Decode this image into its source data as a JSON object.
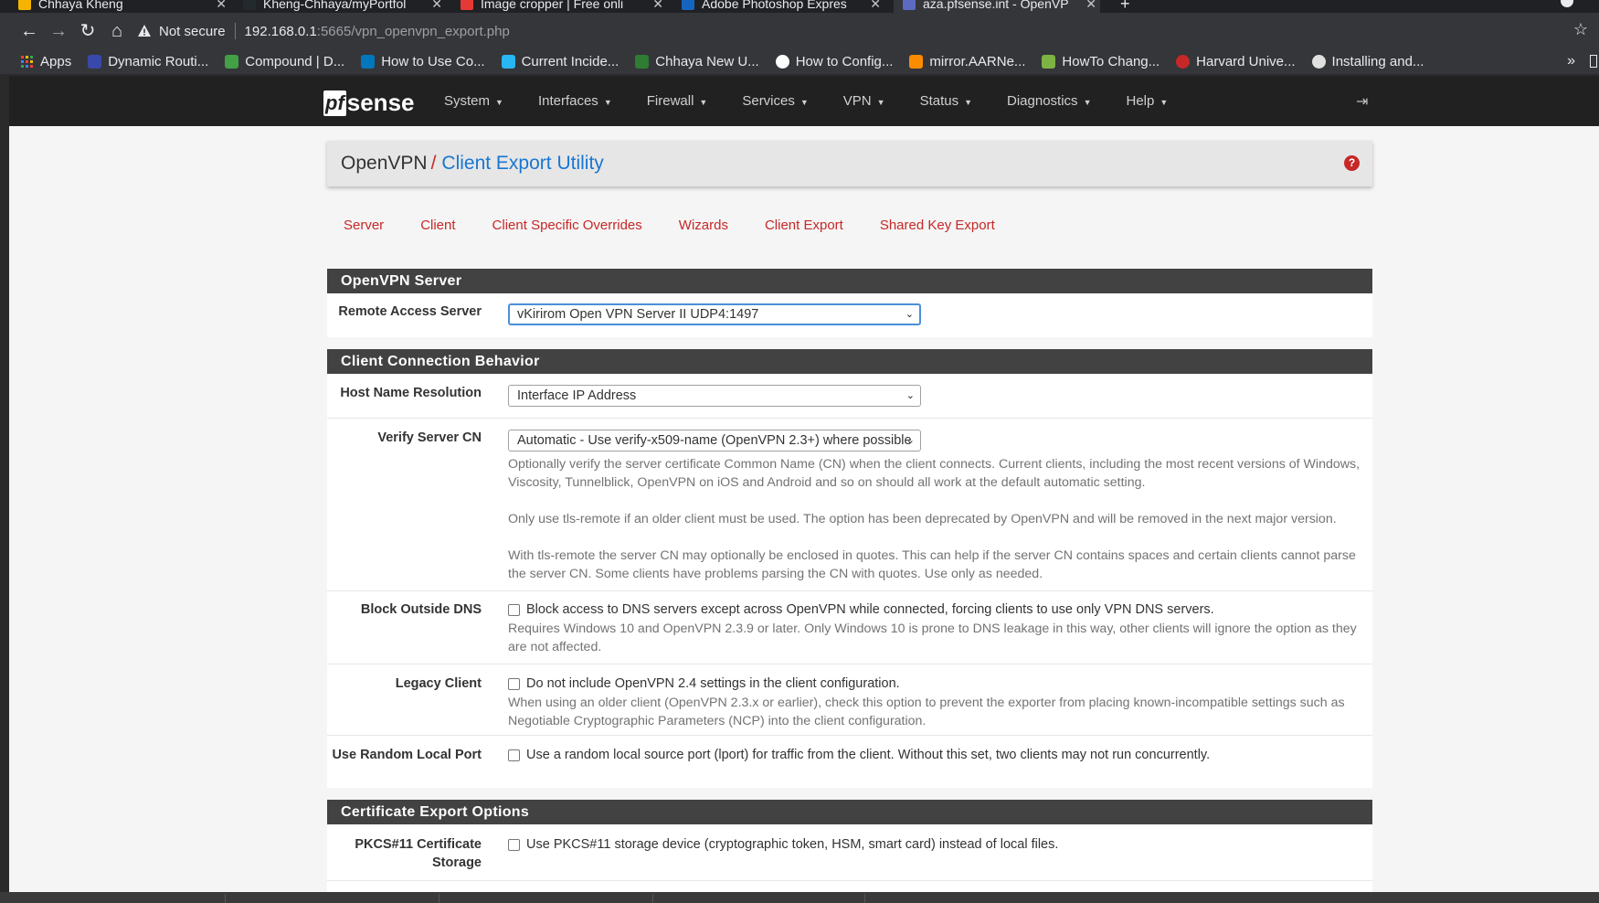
{
  "browser": {
    "tabs": [
      {
        "title": "Chhaya Kheng",
        "color": "#f4b400"
      },
      {
        "title": "Kheng-Chhaya/myPortfol",
        "color": "#24292e"
      },
      {
        "title": "Image cropper | Free onli",
        "color": "#e53935"
      },
      {
        "title": "Adobe Photoshop Expres",
        "color": "#1565c0"
      },
      {
        "title": "aza.pfsense.int - OpenVP",
        "color": "#5c6bc0"
      }
    ],
    "not_secure": "Not secure",
    "url_host": "192.168.0.1",
    "url_path": ":5665/vpn_openvpn_export.php",
    "bookmarks": [
      {
        "label": "Apps",
        "color": "#ea4335"
      },
      {
        "label": "Dynamic Routi...",
        "color": "#3949ab"
      },
      {
        "label": "Compound | D...",
        "color": "#43a047"
      },
      {
        "label": "How to Use Co...",
        "color": "#0277bd"
      },
      {
        "label": "Current Incide...",
        "color": "#29b6f6"
      },
      {
        "label": "Chhaya New U...",
        "color": "#2e7d32"
      },
      {
        "label": "How to Config...",
        "color": "#ffffff"
      },
      {
        "label": "mirror.AARNe...",
        "color": "#fb8c00"
      },
      {
        "label": "HowTo Chang...",
        "color": "#7cb342"
      },
      {
        "label": "Harvard Unive...",
        "color": "#c62828"
      },
      {
        "label": "Installing and...",
        "color": "#e0e0e0"
      }
    ]
  },
  "nav": {
    "logo_pf": "pf",
    "logo_sense": "sense",
    "menu": [
      "System",
      "Interfaces",
      "Firewall",
      "Services",
      "VPN",
      "Status",
      "Diagnostics",
      "Help"
    ]
  },
  "breadcrumb": {
    "root": "OpenVPN",
    "slash": "/",
    "current": "Client Export Utility",
    "help": "?"
  },
  "tabs": [
    "Server",
    "Client",
    "Client Specific Overrides",
    "Wizards",
    "Client Export",
    "Shared Key Export"
  ],
  "openvpn_server": {
    "heading": "OpenVPN Server",
    "remote_access_label": "Remote Access Server",
    "remote_access_value": "vKirirom Open VPN Server II UDP4:1497"
  },
  "client_connection": {
    "heading": "Client Connection Behavior",
    "host_name_label": "Host Name Resolution",
    "host_name_value": "Interface IP Address",
    "verify_cn_label": "Verify Server CN",
    "verify_cn_value": "Automatic - Use verify-x509-name (OpenVPN 2.3+) where possible",
    "verify_cn_help1": "Optionally verify the server certificate Common Name (CN) when the client connects. Current clients, including the most recent versions of Windows, Viscosity, Tunnelblick, OpenVPN on iOS and Android and so on should all work at the default automatic setting.",
    "verify_cn_help2": "Only use tls-remote if an older client must be used. The option has been deprecated by OpenVPN and will be removed in the next major version.",
    "verify_cn_help3": "With tls-remote the server CN may optionally be enclosed in quotes. This can help if the server CN contains spaces and certain clients cannot parse the server CN. Some clients have problems parsing the CN with quotes. Use only as needed.",
    "block_dns_label": "Block Outside DNS",
    "block_dns_check": "Block access to DNS servers except across OpenVPN while connected, forcing clients to use only VPN DNS servers.",
    "block_dns_help": "Requires Windows 10 and OpenVPN 2.3.9 or later. Only Windows 10 is prone to DNS leakage in this way, other clients will ignore the option as they are not affected.",
    "legacy_label": "Legacy Client",
    "legacy_check": "Do not include OpenVPN 2.4 settings in the client configuration.",
    "legacy_help": "When using an older client (OpenVPN 2.3.x or earlier), check this option to prevent the exporter from placing known-incompatible settings such as Negotiable Cryptographic Parameters (NCP) into the client configuration.",
    "random_port_label": "Use Random Local Port",
    "random_port_check": "Use a random local source port (lport) for traffic from the client. Without this set, two clients may not run concurrently."
  },
  "cert_export": {
    "heading": "Certificate Export Options",
    "pkcs_label_1": "PKCS#11 Certificate",
    "pkcs_label_2": "Storage",
    "pkcs_check": "Use PKCS#11 storage device (cryptographic token, HSM, smart card) instead of local files."
  }
}
